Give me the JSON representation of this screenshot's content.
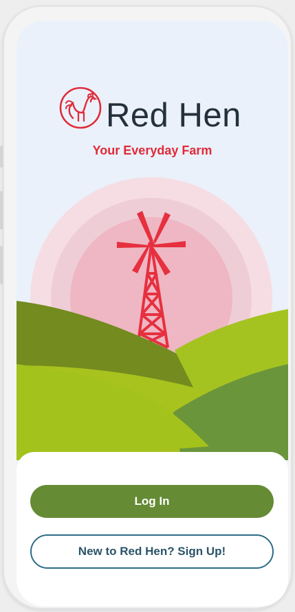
{
  "brand": {
    "name": "Red Hen",
    "tagline": "Your Everyday Farm",
    "colors": {
      "red": "#e02a39",
      "dark": "#24303c",
      "green": "#658b34",
      "teal": "#2c6b86"
    }
  },
  "icons": {
    "logo": "rooster-icon",
    "illustration": "windmill-icon"
  },
  "auth": {
    "login_label": "Log In",
    "signup_label": "New to Red Hen? Sign Up!"
  }
}
